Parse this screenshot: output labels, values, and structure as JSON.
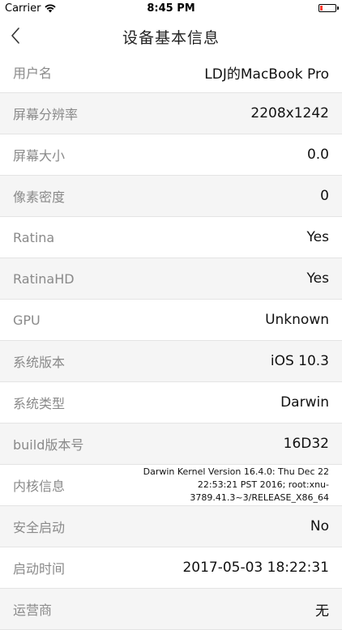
{
  "status_bar": {
    "carrier": "Carrier",
    "time": "8:45 PM",
    "battery_level": 0.15,
    "battery_color": "#ff3b30"
  },
  "nav": {
    "title": "设备基本信息",
    "back_icon": "chevron-left-icon"
  },
  "rows": [
    {
      "label": "用户名",
      "value": "LDJ的MacBook Pro"
    },
    {
      "label": "屏幕分辨率",
      "value": "2208x1242"
    },
    {
      "label": "屏幕大小",
      "value": "0.0"
    },
    {
      "label": "像素密度",
      "value": "0"
    },
    {
      "label": "Ratina",
      "value": "Yes"
    },
    {
      "label": "RatinaHD",
      "value": "Yes"
    },
    {
      "label": "GPU",
      "value": "Unknown"
    },
    {
      "label": "系统版本",
      "value": "iOS 10.3"
    },
    {
      "label": "系统类型",
      "value": "Darwin"
    },
    {
      "label": "build版本号",
      "value": "16D32"
    },
    {
      "label": "内核信息",
      "value": "Darwin Kernel Version 16.4.0: Thu Dec 22 22:53:21 PST 2016; root:xnu-3789.41.3~3/RELEASE_X86_64"
    },
    {
      "label": "安全启动",
      "value": "No"
    },
    {
      "label": "启动时间",
      "value": "2017-05-03 18:22:31"
    },
    {
      "label": "运营商",
      "value": "无"
    }
  ]
}
